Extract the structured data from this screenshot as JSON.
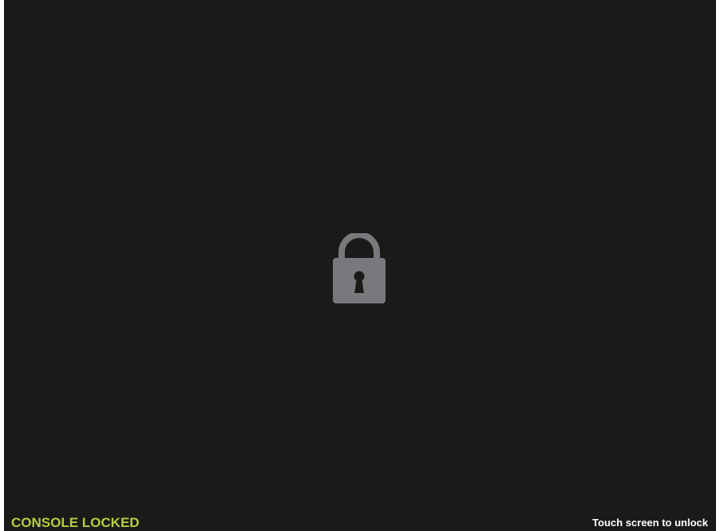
{
  "status": {
    "locked_label": "CONSOLE LOCKED",
    "unlock_hint": "Touch screen to unlock"
  },
  "icons": {
    "center": "lock-icon"
  },
  "colors": {
    "background": "#1a1a19",
    "lock": "#78787d",
    "keyhole": "#1a1a19",
    "locked_label": "#b5cc3e",
    "unlock_hint": "#ffffff"
  }
}
